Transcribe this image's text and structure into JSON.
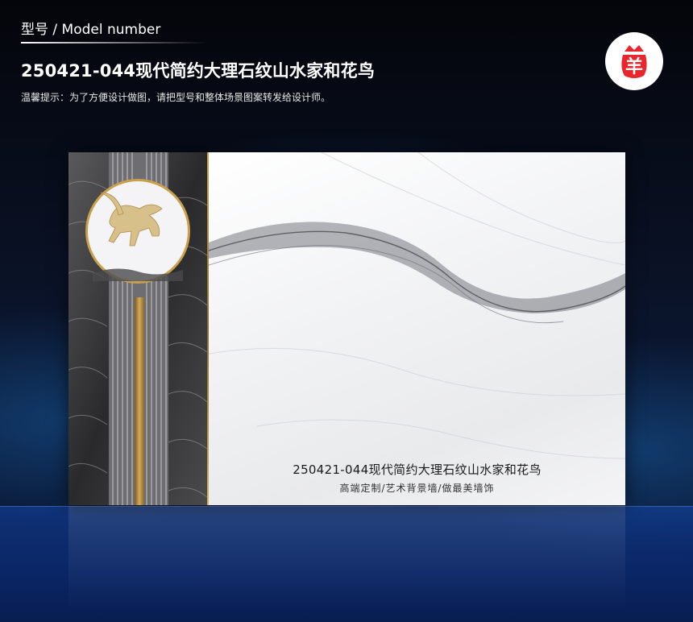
{
  "header": {
    "model_label": "型号 / Model number",
    "title": "250421-044现代简约大理石纹山水家和花鸟",
    "tip": "温馨提示：为了方便设计做图，请把型号和整体场景图案转发给设计师。"
  },
  "logo": {
    "icon": "sheep-bag-icon",
    "glyph": "羊",
    "color": "#e8262b"
  },
  "product": {
    "caption_main": "250421-044现代简约大理石纹山水家和花鸟",
    "caption_sub": "高端定制/艺术背景墙/做最美墙饰"
  },
  "colors": {
    "accent_gold": "#c9a04c",
    "background_blue": "#0b1a3a",
    "logo_red": "#e8262b"
  }
}
